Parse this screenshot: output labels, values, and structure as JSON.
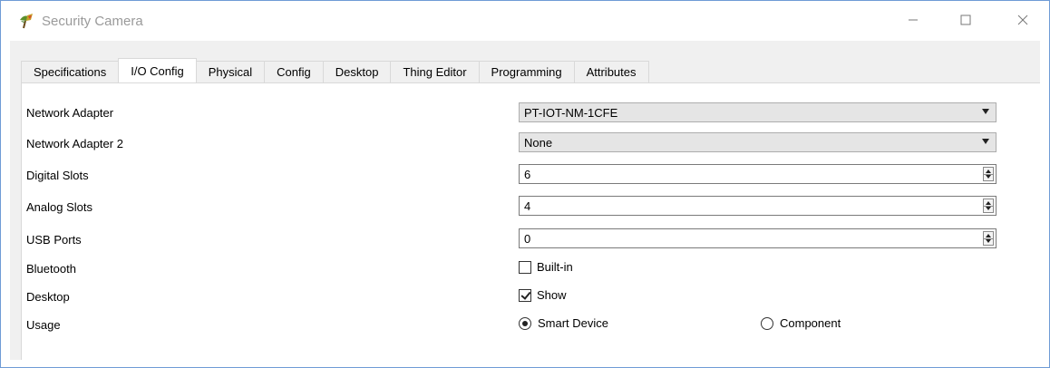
{
  "window": {
    "title": "Security Camera",
    "icon": "plant-camera-icon",
    "controls": {
      "minimize": "—",
      "maximize": "☐",
      "close": "✕"
    }
  },
  "tabs": [
    {
      "label": "Specifications",
      "active": false
    },
    {
      "label": "I/O Config",
      "active": true
    },
    {
      "label": "Physical",
      "active": false
    },
    {
      "label": "Config",
      "active": false
    },
    {
      "label": "Desktop",
      "active": false
    },
    {
      "label": "Thing Editor",
      "active": false
    },
    {
      "label": "Programming",
      "active": false
    },
    {
      "label": "Attributes",
      "active": false
    }
  ],
  "fields": {
    "network_adapter": {
      "label": "Network Adapter",
      "value": "PT-IOT-NM-1CFE"
    },
    "network_adapter_2": {
      "label": "Network Adapter 2",
      "value": "None"
    },
    "digital_slots": {
      "label": "Digital Slots",
      "value": "6"
    },
    "analog_slots": {
      "label": "Analog Slots",
      "value": "4"
    },
    "usb_ports": {
      "label": "USB Ports",
      "value": "0"
    },
    "bluetooth": {
      "label": "Bluetooth",
      "option": "Built-in",
      "checked": false
    },
    "desktop": {
      "label": "Desktop",
      "option": "Show",
      "checked": true
    },
    "usage": {
      "label": "Usage",
      "option1": "Smart Device",
      "option2": "Component",
      "selected": "Smart Device"
    }
  }
}
